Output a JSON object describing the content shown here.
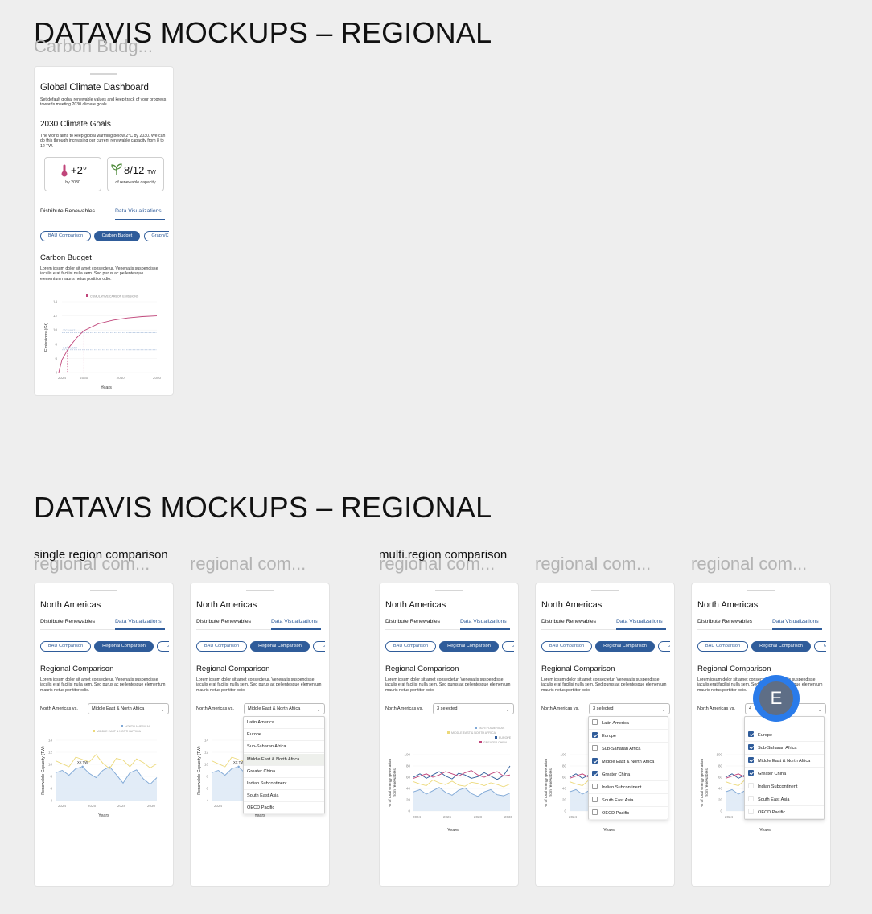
{
  "canvas": {
    "section_titles": [
      "DATAVIS MOCKUPS – REGIONAL",
      "DATAVIS MOCKUPS – REGIONAL"
    ],
    "group_labels": {
      "single": "single region comparison",
      "multi": "multi region comparison"
    }
  },
  "carbon_frame": {
    "frame_label": "Carbon Budg...",
    "title": "Global Climate Dashboard",
    "intro": "Set default global renewable values and keep track of your progress towards meeting 2030 climate goals.",
    "goals_title": "2030 Climate Goals",
    "goals_text": "The world aims to keep global warming below 2°C by 2030. We can do this through increasing our current renewable capacity from 8 to 12 TW.",
    "stat_temp": {
      "value": "+2°",
      "sub": "by 2030",
      "icon": "thermometer-icon"
    },
    "stat_renew": {
      "value": "8/12",
      "unit": "TW",
      "sub": "of renewable capacity",
      "icon": "sprout-icon"
    },
    "tab_left": "Distribute Renewables",
    "tab_right": "Data Visualizations",
    "pills": [
      "BAU Comparison",
      "Carbon Budget",
      "Graph/C"
    ],
    "section_title": "Carbon Budget",
    "lorem": "Lorem ipsum dolor sit amet consectetur. Venenatis suspendisse iaculis erat facilisi nulla sem. Sed purus ac pellentesque elementum mauris netus porttitor odio."
  },
  "regional_frames": [
    {
      "frame_label": "regional com..."
    },
    {
      "frame_label": "regional com..."
    },
    {
      "frame_label": "regional com..."
    },
    {
      "frame_label": "regional com..."
    },
    {
      "frame_label": "regional com..."
    }
  ],
  "regional_common": {
    "title": "North Americas",
    "tab_left": "Distribute Renewables",
    "tab_right": "Data Visualizations",
    "pills": [
      "BAU Comparison",
      "Regional Comparison",
      "Gr"
    ],
    "section_title": "Regional Comparison",
    "lorem": "Lorem ipsum dolor sit amet consectetur. Venenatis suspendisse iaculis erat facilisi nulla sem. Sed purus ac pellentesque elementum mauris netus porttitor odio.",
    "vs_label": "North Americas vs.",
    "single_value": "Middle East & North Africa",
    "multi_value": "3 selected",
    "multi_value_partial": "4"
  },
  "region_options": [
    "Latin America",
    "Europe",
    "Sub-Saharan Africa",
    "Middle East & North Africa",
    "Greater China",
    "Indian Subcontinent",
    "South East Asia",
    "OECD Pacific"
  ],
  "multi_checked": [
    false,
    true,
    false,
    true,
    true,
    false,
    false,
    false
  ],
  "multi_checked_4": [
    true,
    true,
    true,
    true,
    false,
    false
  ],
  "multi_options_4": [
    "Europe",
    "Sub-Saharan Africa",
    "Middle East & North Africa",
    "Greater China",
    "Indian Subcontinent",
    "South East Asia",
    "OECD Pacific"
  ],
  "avatar_letter": "E",
  "chart_data": [
    {
      "type": "line",
      "name_ref": "carbon-budget-chart",
      "legend": [
        "CUMULATIVE CARBON EMISSIONS"
      ],
      "xlabel": "Years",
      "ylabel": "Emissions (Gt)",
      "xticks": [
        "2024",
        "2030",
        "2040",
        "2050"
      ],
      "yticks": [
        4,
        6,
        8,
        10,
        12,
        14
      ],
      "ylim": [
        4,
        14
      ],
      "xlim": [
        2024,
        2050
      ],
      "annotations": [
        "1.5°C LIMIT",
        "2°C LIMIT"
      ],
      "series": [
        {
          "name": "CUMULATIVE CARBON EMISSIONS",
          "x": [
            2022,
            2024,
            2026,
            2028,
            2030,
            2034,
            2038,
            2042,
            2046,
            2050
          ],
          "y": [
            4,
            5.8,
            7.6,
            8.9,
            9.9,
            10.9,
            11.4,
            11.7,
            11.9,
            12.0
          ]
        }
      ],
      "color": "#c0457a"
    },
    {
      "type": "area",
      "name_ref": "single-region-chart",
      "legend": [
        "NORTH AMERICAS",
        "MIDDLE EAST & NORTH AFRICA"
      ],
      "xlabel": "Years",
      "ylabel": "Renewable Capacity (TW)",
      "xticks": [
        "2024",
        "2026",
        "2028",
        "2030"
      ],
      "yticks": [
        4,
        6,
        8,
        10,
        12,
        14
      ],
      "ylim": [
        4,
        14
      ],
      "data_label": "XX TW",
      "series": [
        {
          "name": "NORTH AMERICAS",
          "values": [
            8.6,
            9.0,
            8.2,
            9.3,
            9.6,
            8.5,
            7.8,
            9.0,
            9.6,
            8.3,
            6.9,
            8.6,
            9.1,
            7.6,
            6.7,
            7.8
          ]
        },
        {
          "name": "MIDDLE EAST & NORTH AFRICA",
          "values": [
            10.6,
            10.1,
            9.6,
            11.2,
            10.8,
            10.4,
            11.6,
            10.2,
            9.3,
            11.0,
            10.7,
            9.6,
            10.9,
            10.3,
            9.4,
            10.1
          ]
        }
      ],
      "colors": {
        "NORTH AMERICAS": "#7fa8d6",
        "MIDDLE EAST & NORTH AFRICA": "#ecd97a"
      }
    },
    {
      "type": "line",
      "name_ref": "multi-region-chart",
      "legend": [
        "NORTH AMERICAS",
        "MIDDLE EAST & NORTH AFRICA",
        "EUROPE",
        "GREATER CHINA"
      ],
      "xlabel": "Years",
      "ylabel": "% of total energy generation from renewables",
      "xticks": [
        "2024",
        "2026",
        "2028",
        "2030"
      ],
      "yticks": [
        0,
        20,
        40,
        60,
        80,
        100
      ],
      "ylim": [
        0,
        100
      ],
      "series": [
        {
          "name": "NORTH AMERICAS",
          "values": [
            34,
            38,
            30,
            36,
            42,
            33,
            28,
            37,
            41,
            31,
            26,
            34,
            38,
            29,
            27,
            32
          ]
        },
        {
          "name": "MIDDLE EAST & NORTH AFRICA",
          "values": [
            52,
            48,
            45,
            55,
            50,
            47,
            53,
            46,
            44,
            51,
            49,
            45,
            50,
            47,
            43,
            48
          ]
        },
        {
          "name": "EUROPE",
          "values": [
            60,
            66,
            58,
            64,
            70,
            62,
            57,
            67,
            64,
            58,
            61,
            68,
            62,
            56,
            63,
            80
          ]
        },
        {
          "name": "GREATER CHINA",
          "values": [
            58,
            62,
            66,
            60,
            64,
            70,
            66,
            62,
            68,
            72,
            64,
            60,
            66,
            70,
            62,
            64
          ]
        }
      ],
      "colors": {
        "NORTH AMERICAS": "#7fa8d6",
        "MIDDLE EAST & NORTH AFRICA": "#ecd97a",
        "EUROPE": "#2f5c9a",
        "GREATER CHINA": "#c0457a"
      }
    }
  ]
}
